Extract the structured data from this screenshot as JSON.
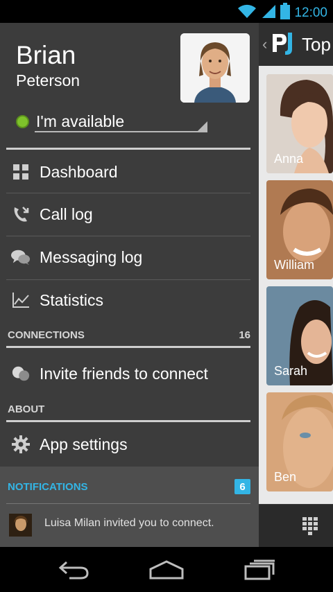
{
  "status_bar": {
    "time": "12:00",
    "icons": [
      "wifi-icon",
      "signal-icon",
      "battery-icon"
    ],
    "accent": "#33b5e5"
  },
  "profile": {
    "first_name": "Brian",
    "last_name": "Peterson",
    "availability": "I'm available",
    "availability_color": "#7ec22b"
  },
  "menu": {
    "dashboard": "Dashboard",
    "call_log": "Call log",
    "messaging_log": "Messaging log",
    "statistics": "Statistics"
  },
  "connections": {
    "header": "CONNECTIONS",
    "count": "16",
    "invite": "Invite friends to connect"
  },
  "about": {
    "header": "ABOUT",
    "app_settings": "App settings"
  },
  "notifications": {
    "header": "NOTIFICATIONS",
    "count": "6",
    "message": "Luisa Milan invited you to connect."
  },
  "content": {
    "title": "Top",
    "people": [
      "Anna",
      "William",
      "Sarah",
      "Ben"
    ]
  },
  "nav": {
    "icons": [
      "back-icon",
      "home-icon",
      "recents-icon"
    ]
  }
}
